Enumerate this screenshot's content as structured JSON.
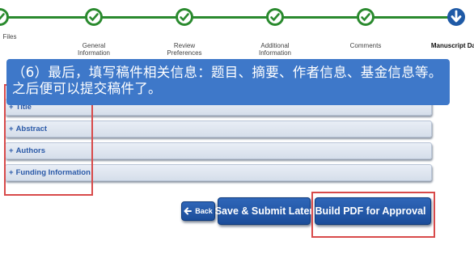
{
  "stepper": {
    "steps": [
      {
        "label": "Files"
      },
      {
        "label": "General Information"
      },
      {
        "label": "Review Preferences"
      },
      {
        "label": "Additional Information"
      },
      {
        "label": "Comments"
      },
      {
        "label": "Manuscript Data"
      }
    ],
    "colors": {
      "complete": "#2a8a2e",
      "current": "#1f5aa6"
    }
  },
  "callout": {
    "text": "（6）最后，填写稿件相关信息：题目、摘要、作者信息、基金信息等。之后便可以提交稿件了。"
  },
  "sections": [
    {
      "plus": "+",
      "label": "Title"
    },
    {
      "plus": "+",
      "label": "Abstract"
    },
    {
      "plus": "+",
      "label": "Authors"
    },
    {
      "plus": "+",
      "label": "Funding Information"
    }
  ],
  "buttons": {
    "back": "Back",
    "save_later": "Save & Submit Later",
    "build_pdf": "Build PDF for Approval"
  },
  "icons": {
    "complete": "check-circle-icon",
    "current": "down-arrow-circle-icon",
    "back": "left-arrow-icon",
    "forward": "right-arrow-icon"
  }
}
